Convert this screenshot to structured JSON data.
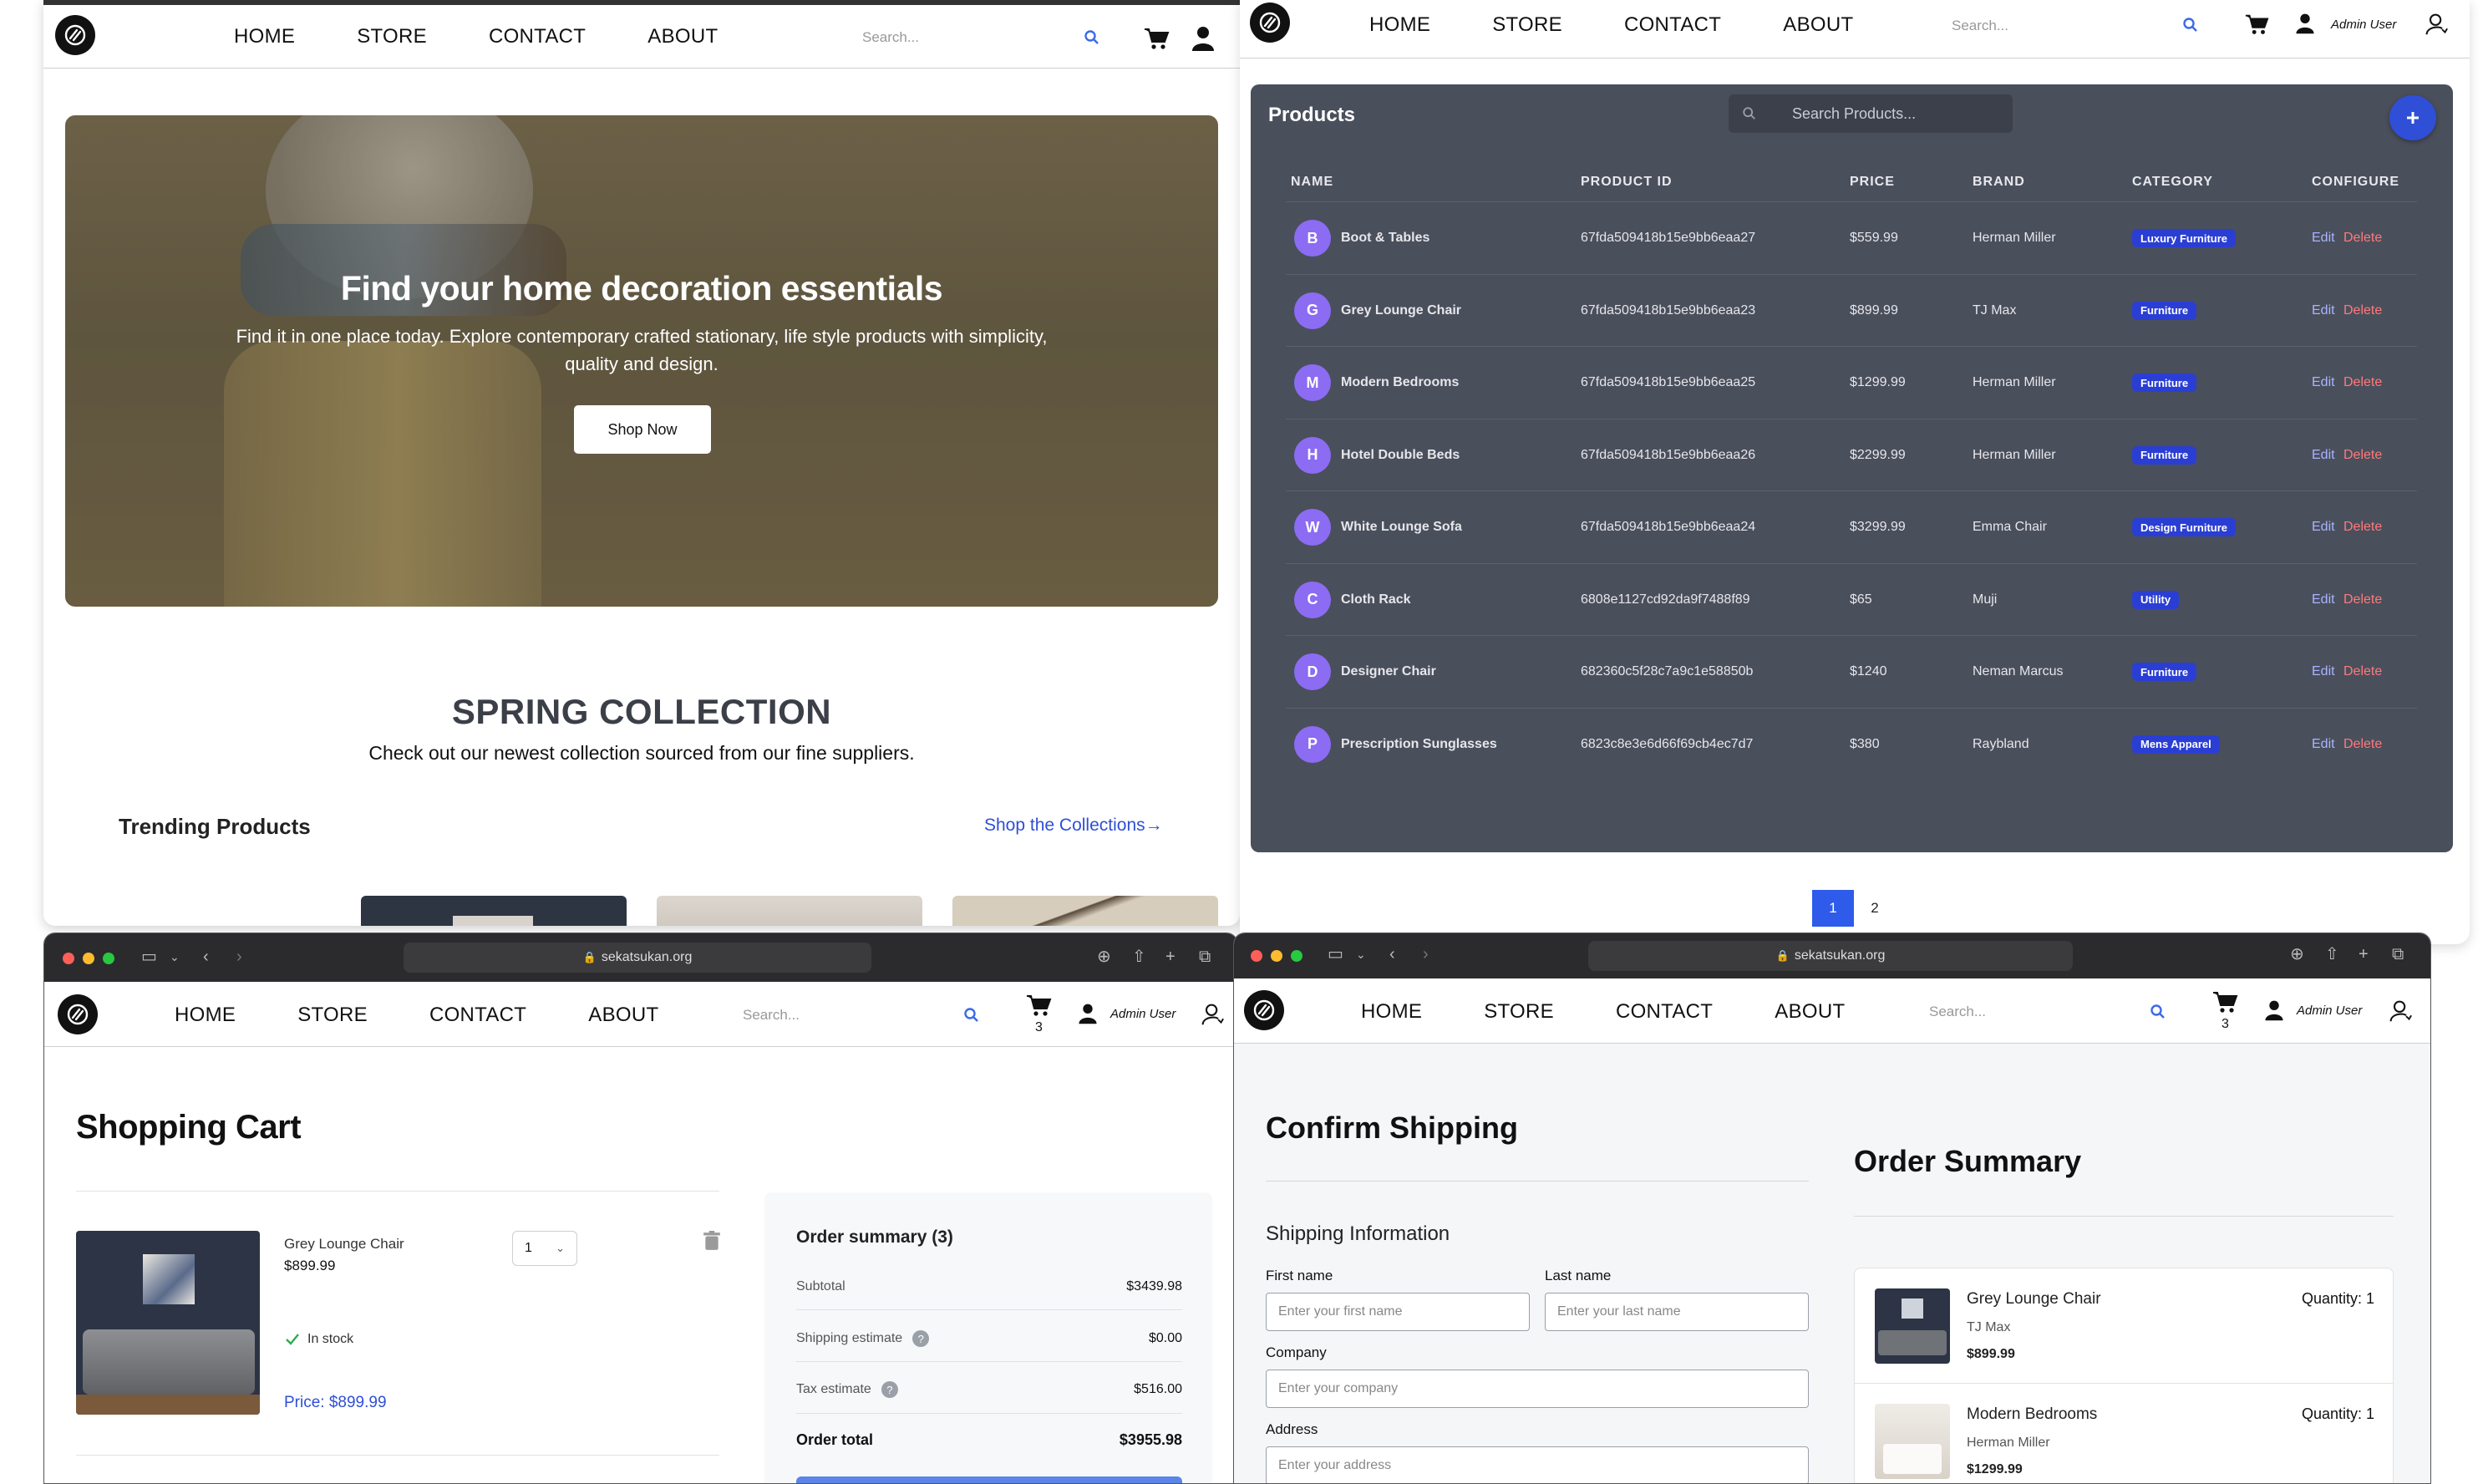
{
  "nav": {
    "links": [
      "HOME",
      "STORE",
      "CONTACT",
      "ABOUT"
    ],
    "search_placeholder": "Search...",
    "admin_user": "Admin User",
    "cart_count": "3"
  },
  "home": {
    "hero_title": "Find your home decoration essentials",
    "hero_subtitle_1": "Find it in one place today. Explore contemporary crafted stationary, life style products with simplicity,",
    "hero_subtitle_2": "quality and design.",
    "shop_now": "Shop Now",
    "collection_title": "SPRING COLLECTION",
    "collection_sub": "Check out our newest collection sourced from our fine suppliers.",
    "trending": "Trending Products",
    "shop_collections": "Shop the Collections→"
  },
  "products": {
    "title": "Products",
    "search_placeholder": "Search Products...",
    "add_icon": "plus-icon",
    "columns": [
      "NAME",
      "PRODUCT ID",
      "PRICE",
      "BRAND",
      "CATEGORY",
      "CONFIGURE"
    ],
    "rows": [
      {
        "initial": "B",
        "name": "Boot & Tables",
        "id": "67fda509418b15e9bb6eaa27",
        "price": "$559.99",
        "brand": "Herman Miller",
        "category": "Luxury Furniture"
      },
      {
        "initial": "G",
        "name": "Grey Lounge Chair",
        "id": "67fda509418b15e9bb6eaa23",
        "price": "$899.99",
        "brand": "TJ Max",
        "category": "Furniture"
      },
      {
        "initial": "M",
        "name": "Modern Bedrooms",
        "id": "67fda509418b15e9bb6eaa25",
        "price": "$1299.99",
        "brand": "Herman Miller",
        "category": "Furniture"
      },
      {
        "initial": "H",
        "name": "Hotel Double Beds",
        "id": "67fda509418b15e9bb6eaa26",
        "price": "$2299.99",
        "brand": "Herman Miller",
        "category": "Furniture"
      },
      {
        "initial": "W",
        "name": "White Lounge Sofa",
        "id": "67fda509418b15e9bb6eaa24",
        "price": "$3299.99",
        "brand": "Emma Chair",
        "category": "Design Furniture"
      },
      {
        "initial": "C",
        "name": "Cloth Rack",
        "id": "6808e1127cd92da9f7488f89",
        "price": "$65",
        "brand": "Muji",
        "category": "Utility"
      },
      {
        "initial": "D",
        "name": "Designer Chair",
        "id": "682360c5f28c7a9c1e58850b",
        "price": "$1240",
        "brand": "Neman Marcus",
        "category": "Furniture"
      },
      {
        "initial": "P",
        "name": "Prescription Sunglasses",
        "id": "6823c8e3e6d66f69cb4ec7d7",
        "price": "$380",
        "brand": "Raybland",
        "category": "Mens Apparel"
      }
    ],
    "edit": "Edit",
    "delete": "Delete",
    "pages": [
      "1",
      "2"
    ]
  },
  "browser": {
    "url": "sekatsukan.org"
  },
  "cart": {
    "title": "Shopping Cart",
    "item_name": "Grey Lounge Chair",
    "item_price": "$899.99",
    "qty": "1",
    "in_stock": "In stock",
    "price_line": "Price: $899.99",
    "summary_title": "Order summary (3)",
    "subtotal_label": "Subtotal",
    "subtotal": "$3439.98",
    "shipping_label": "Shipping estimate",
    "shipping": "$0.00",
    "tax_label": "Tax estimate",
    "tax": "$516.00",
    "total_label": "Order total",
    "total": "$3955.98"
  },
  "shipping": {
    "title": "Confirm Shipping",
    "section": "Shipping Information",
    "first_name_label": "First name",
    "first_name_placeholder": "Enter your first name",
    "last_name_label": "Last name",
    "last_name_placeholder": "Enter your last name",
    "company_label": "Company",
    "company_placeholder": "Enter your company",
    "address_label": "Address",
    "address_placeholder": "Enter your address",
    "summary_title": "Order Summary",
    "items": [
      {
        "name": "Grey Lounge Chair",
        "brand": "TJ Max",
        "price": "$899.99",
        "qty": "Quantity: 1"
      },
      {
        "name": "Modern Bedrooms",
        "brand": "Herman Miller",
        "price": "$1299.99",
        "qty": "Quantity: 1"
      }
    ]
  },
  "colors": {
    "accent_blue": "#2f5bea",
    "table_bg": "#4a4f5c",
    "badge_blue": "#2a3ed4",
    "avatar_purple": "#8b6cf2"
  }
}
